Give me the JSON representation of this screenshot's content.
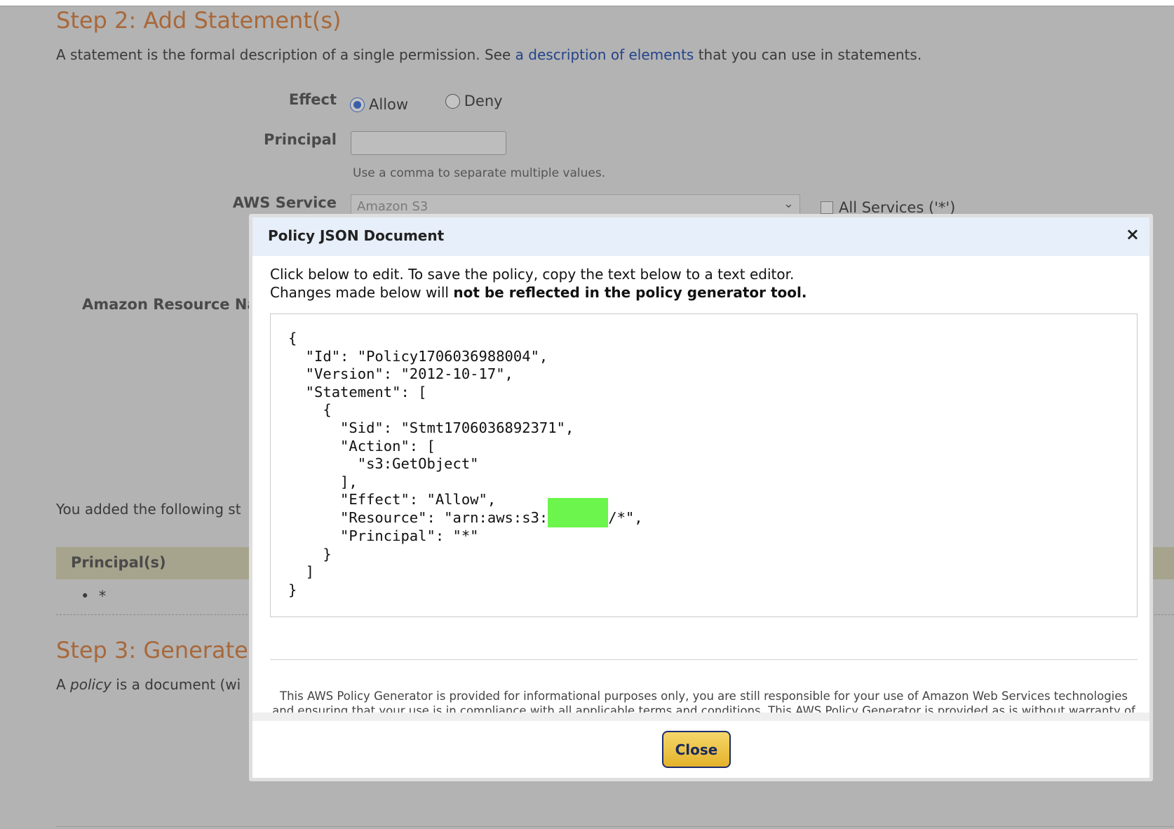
{
  "step2": {
    "title": "Step 2: Add Statement(s)",
    "intro_before": "A statement is the formal description of a single permission. See ",
    "intro_link": "a description of elements",
    "intro_after": " that you can use in statements."
  },
  "form": {
    "effect_label": "Effect",
    "effect_options": [
      "Allow",
      "Deny"
    ],
    "effect_selected": "Allow",
    "principal_label": "Principal",
    "principal_value": "",
    "principal_hint": "Use a comma to separate multiple values.",
    "service_label": "AWS Service",
    "service_value": "Amazon S3",
    "all_services_label": "All Services ('*')",
    "arn_label": "Amazon Resource Na"
  },
  "statements": {
    "added_text": "You added the following st",
    "column_principal": "Principal(s)",
    "principal_items": [
      "*"
    ]
  },
  "step3": {
    "title": "Step 3: Generate",
    "desc_prefix": "A ",
    "desc_italic": "policy",
    "desc_suffix": " is a document (wi"
  },
  "modal": {
    "title": "Policy JSON Document",
    "close_icon": "×",
    "intro_line1": "Click below to edit. To save the policy, copy the text below to a text editor.",
    "intro_line2_prefix": "Changes made below will ",
    "intro_line2_bold": "not be reflected in the policy generator tool.",
    "json_before": "{\n  \"Id\": \"Policy1706036988004\",\n  \"Version\": \"2012-10-17\",\n  \"Statement\": [\n    {\n      \"Sid\": \"Stmt1706036892371\",\n      \"Action\": [\n        \"s3:GetObject\"\n      ],\n      \"Effect\": \"Allow\",\n      \"Resource\": \"arn:aws:s3:",
    "json_after": "/*\",\n      \"Principal\": \"*\"\n    }\n  ]\n}",
    "disclaimer": "This AWS Policy Generator is provided for informational purposes only, you are still responsible for your use of Amazon Web Services technologies and ensuring that your use is in compliance with all applicable terms and conditions. This AWS Policy Generator is provided as is without warranty of any kind, whether express",
    "close_button": "Close"
  },
  "colors": {
    "step_title": "#a8683a",
    "link": "#23448a",
    "modal_header_bg": "#e7effa",
    "redaction": "#6cf54c",
    "close_button": "#e3b22b"
  }
}
